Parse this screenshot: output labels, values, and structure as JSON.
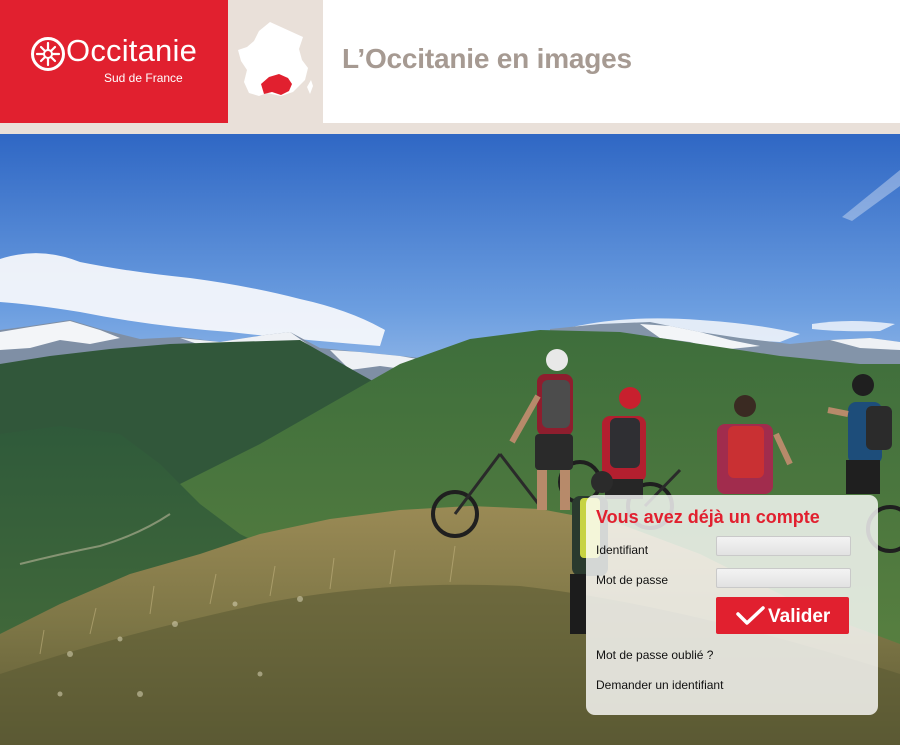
{
  "header": {
    "logo_word": "Occitanie",
    "logo_subtitle": "Sud de France",
    "site_title": "L’Occitanie en images"
  },
  "colors": {
    "brand_red": "#e1202f",
    "header_beige": "#e9e0d9",
    "title_grey": "#a69a92"
  },
  "icons": {
    "logo": "occitan-cross-icon",
    "map": "france-map-icon",
    "submit": "checkmark-icon"
  },
  "login": {
    "title": "Vous avez déjà un compte",
    "username_label": "Identifiant",
    "username_value": "",
    "password_label": "Mot de passe",
    "password_value": "",
    "submit_label": "Valider",
    "forgot_password_link": "Mot de passe oublié ?",
    "request_id_link": "Demander un identifiant"
  }
}
